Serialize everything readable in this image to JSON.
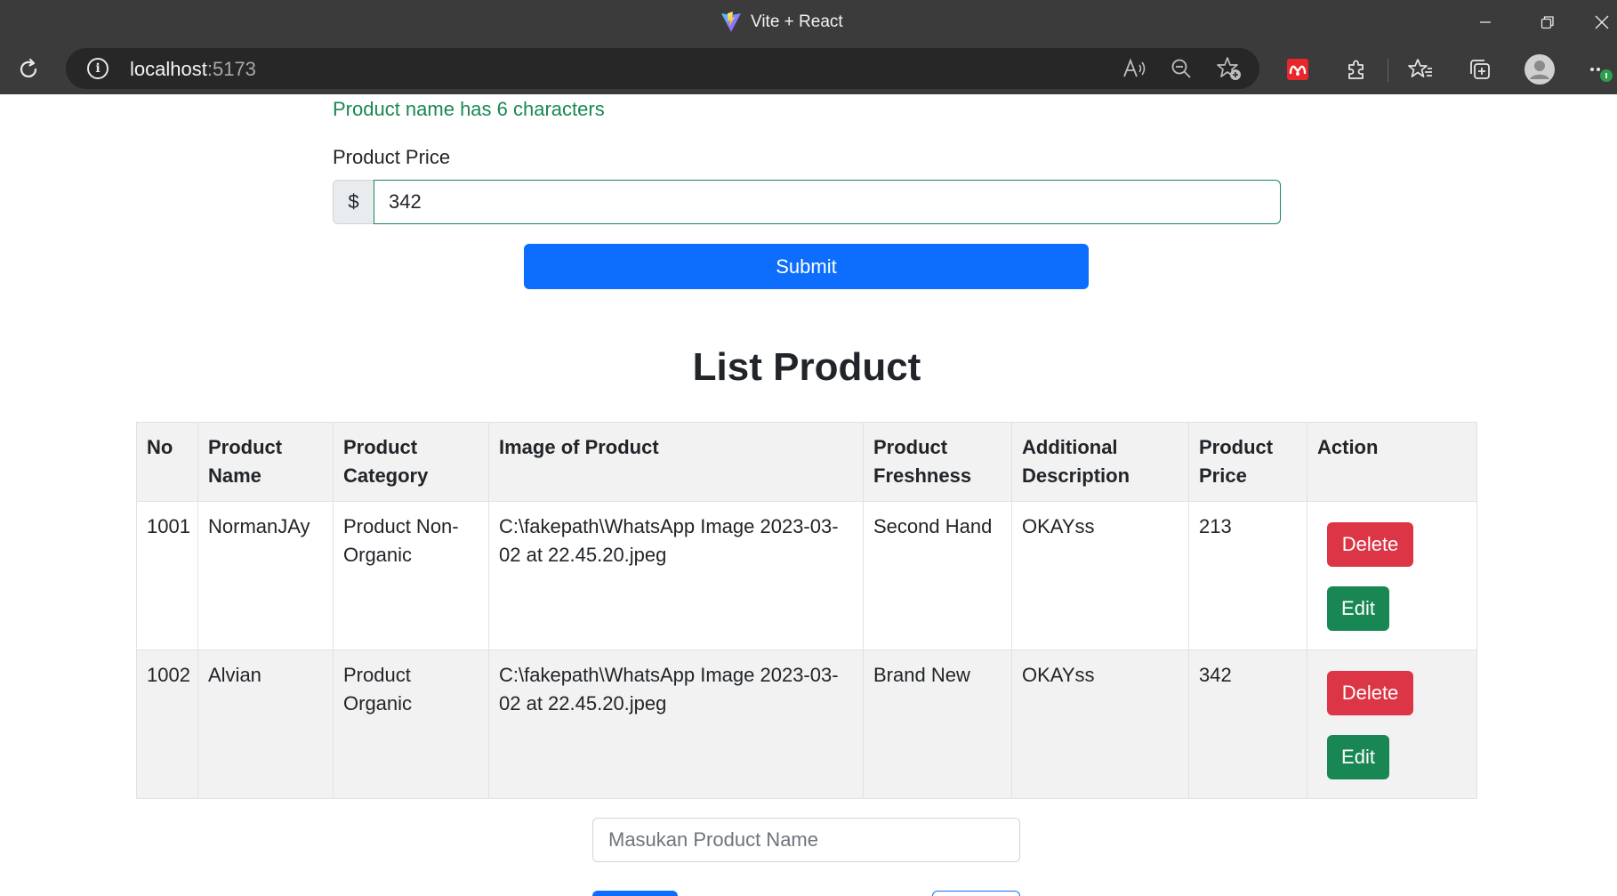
{
  "browser": {
    "tab_title": "Vite + React",
    "url_host": "localhost",
    "url_port": ":5173",
    "window_controls": {
      "minimize_icon": "minimize-icon",
      "restore_icon": "restore-icon",
      "close_icon": "close-icon"
    }
  },
  "form": {
    "validation_message": "Product name has 6 characters",
    "price_label": "Product Price",
    "currency_symbol": "$",
    "price_value": "342",
    "submit_label": "Submit"
  },
  "list": {
    "title": "List Product",
    "columns": [
      "No",
      "Product Name",
      "Product Category",
      "Image of Product",
      "Product Freshness",
      "Additional Description",
      "Product Price",
      "Action"
    ],
    "rows": [
      {
        "no": "1001",
        "name": "NormanJAy",
        "category": "Product Non-Organic",
        "image": "C:\\fakepath\\WhatsApp Image 2023-03-02 at 22.45.20.jpeg",
        "freshness": "Second Hand",
        "description": "OKAYss",
        "price": "213",
        "delete_label": "Delete",
        "edit_label": "Edit"
      },
      {
        "no": "1002",
        "name": "Alvian",
        "category": "Product Organic",
        "image": "C:\\fakepath\\WhatsApp Image 2023-03-02 at 22.45.20.jpeg",
        "freshness": "Brand New",
        "description": "OKAYss",
        "price": "342",
        "delete_label": "Delete",
        "edit_label": "Edit"
      }
    ]
  },
  "search": {
    "placeholder": "Masukan Product Name",
    "value": ""
  },
  "colors": {
    "primary": "#0d6efd",
    "danger": "#dc3545",
    "success": "#198754",
    "chrome_bg": "#3b3b3b"
  }
}
